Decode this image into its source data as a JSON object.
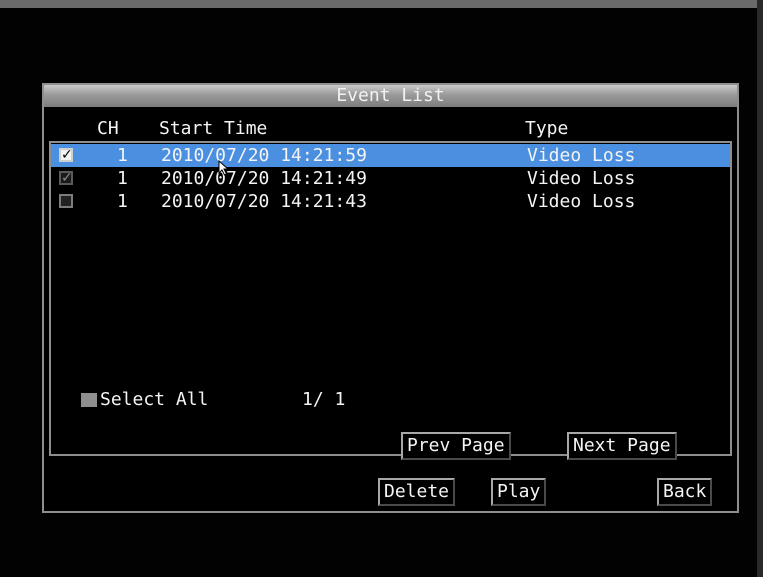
{
  "window": {
    "title": "Event List"
  },
  "columns": {
    "ch": "CH",
    "start_time": "Start Time",
    "type": "Type"
  },
  "events": [
    {
      "checked": true,
      "ch": "1",
      "start_time": "2010/07/20 14:21:59",
      "type": "Video Loss"
    },
    {
      "checked": true,
      "ch": "1",
      "start_time": "2010/07/20 14:21:49",
      "type": "Video Loss"
    },
    {
      "checked": false,
      "ch": "1",
      "start_time": "2010/07/20 14:21:43",
      "type": "Video Loss"
    }
  ],
  "footer": {
    "select_all_label": "Select All",
    "page_indicator": "1/ 1"
  },
  "buttons": {
    "prev_page": "Prev Page",
    "next_page": "Next Page",
    "delete": "Delete",
    "play": "Play",
    "back": "Back"
  },
  "colors": {
    "selection": "#4b8fe0",
    "text": "#f4f4f4",
    "border": "#8e8e8e"
  },
  "icons": {
    "check": "check-icon",
    "cursor": "mouse-pointer-icon"
  }
}
